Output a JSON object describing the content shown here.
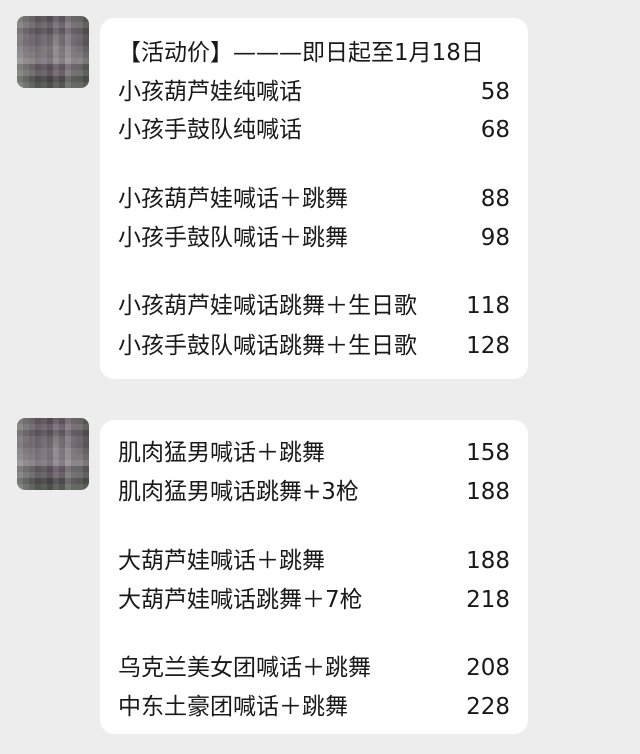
{
  "messages": [
    {
      "header": "【活动价】———即日起至1月18日",
      "items": [
        {
          "label": "小孩葫芦娃纯喊话",
          "price": "58"
        },
        {
          "label": "小孩手鼓队纯喊话",
          "price": "68"
        },
        {
          "label": "小孩葫芦娃喊话＋跳舞",
          "price": "88"
        },
        {
          "label": "小孩手鼓队喊话＋跳舞",
          "price": "98"
        },
        {
          "label": "小孩葫芦娃喊话跳舞＋生日歌",
          "price": "118"
        },
        {
          "label": "小孩手鼓队喊话跳舞＋生日歌",
          "price": "128"
        }
      ]
    },
    {
      "items": [
        {
          "label": "肌肉猛男喊话＋跳舞",
          "price": "158"
        },
        {
          "label": "肌肉猛男喊话跳舞+3枪",
          "price": "188"
        },
        {
          "label": "大葫芦娃喊话＋跳舞",
          "price": "188"
        },
        {
          "label": "大葫芦娃喊话跳舞＋7枪",
          "price": "218"
        },
        {
          "label": "乌克兰美女团喊话＋跳舞",
          "price": "208"
        },
        {
          "label": "中东土豪团喊话＋跳舞",
          "price": "228"
        }
      ]
    }
  ]
}
